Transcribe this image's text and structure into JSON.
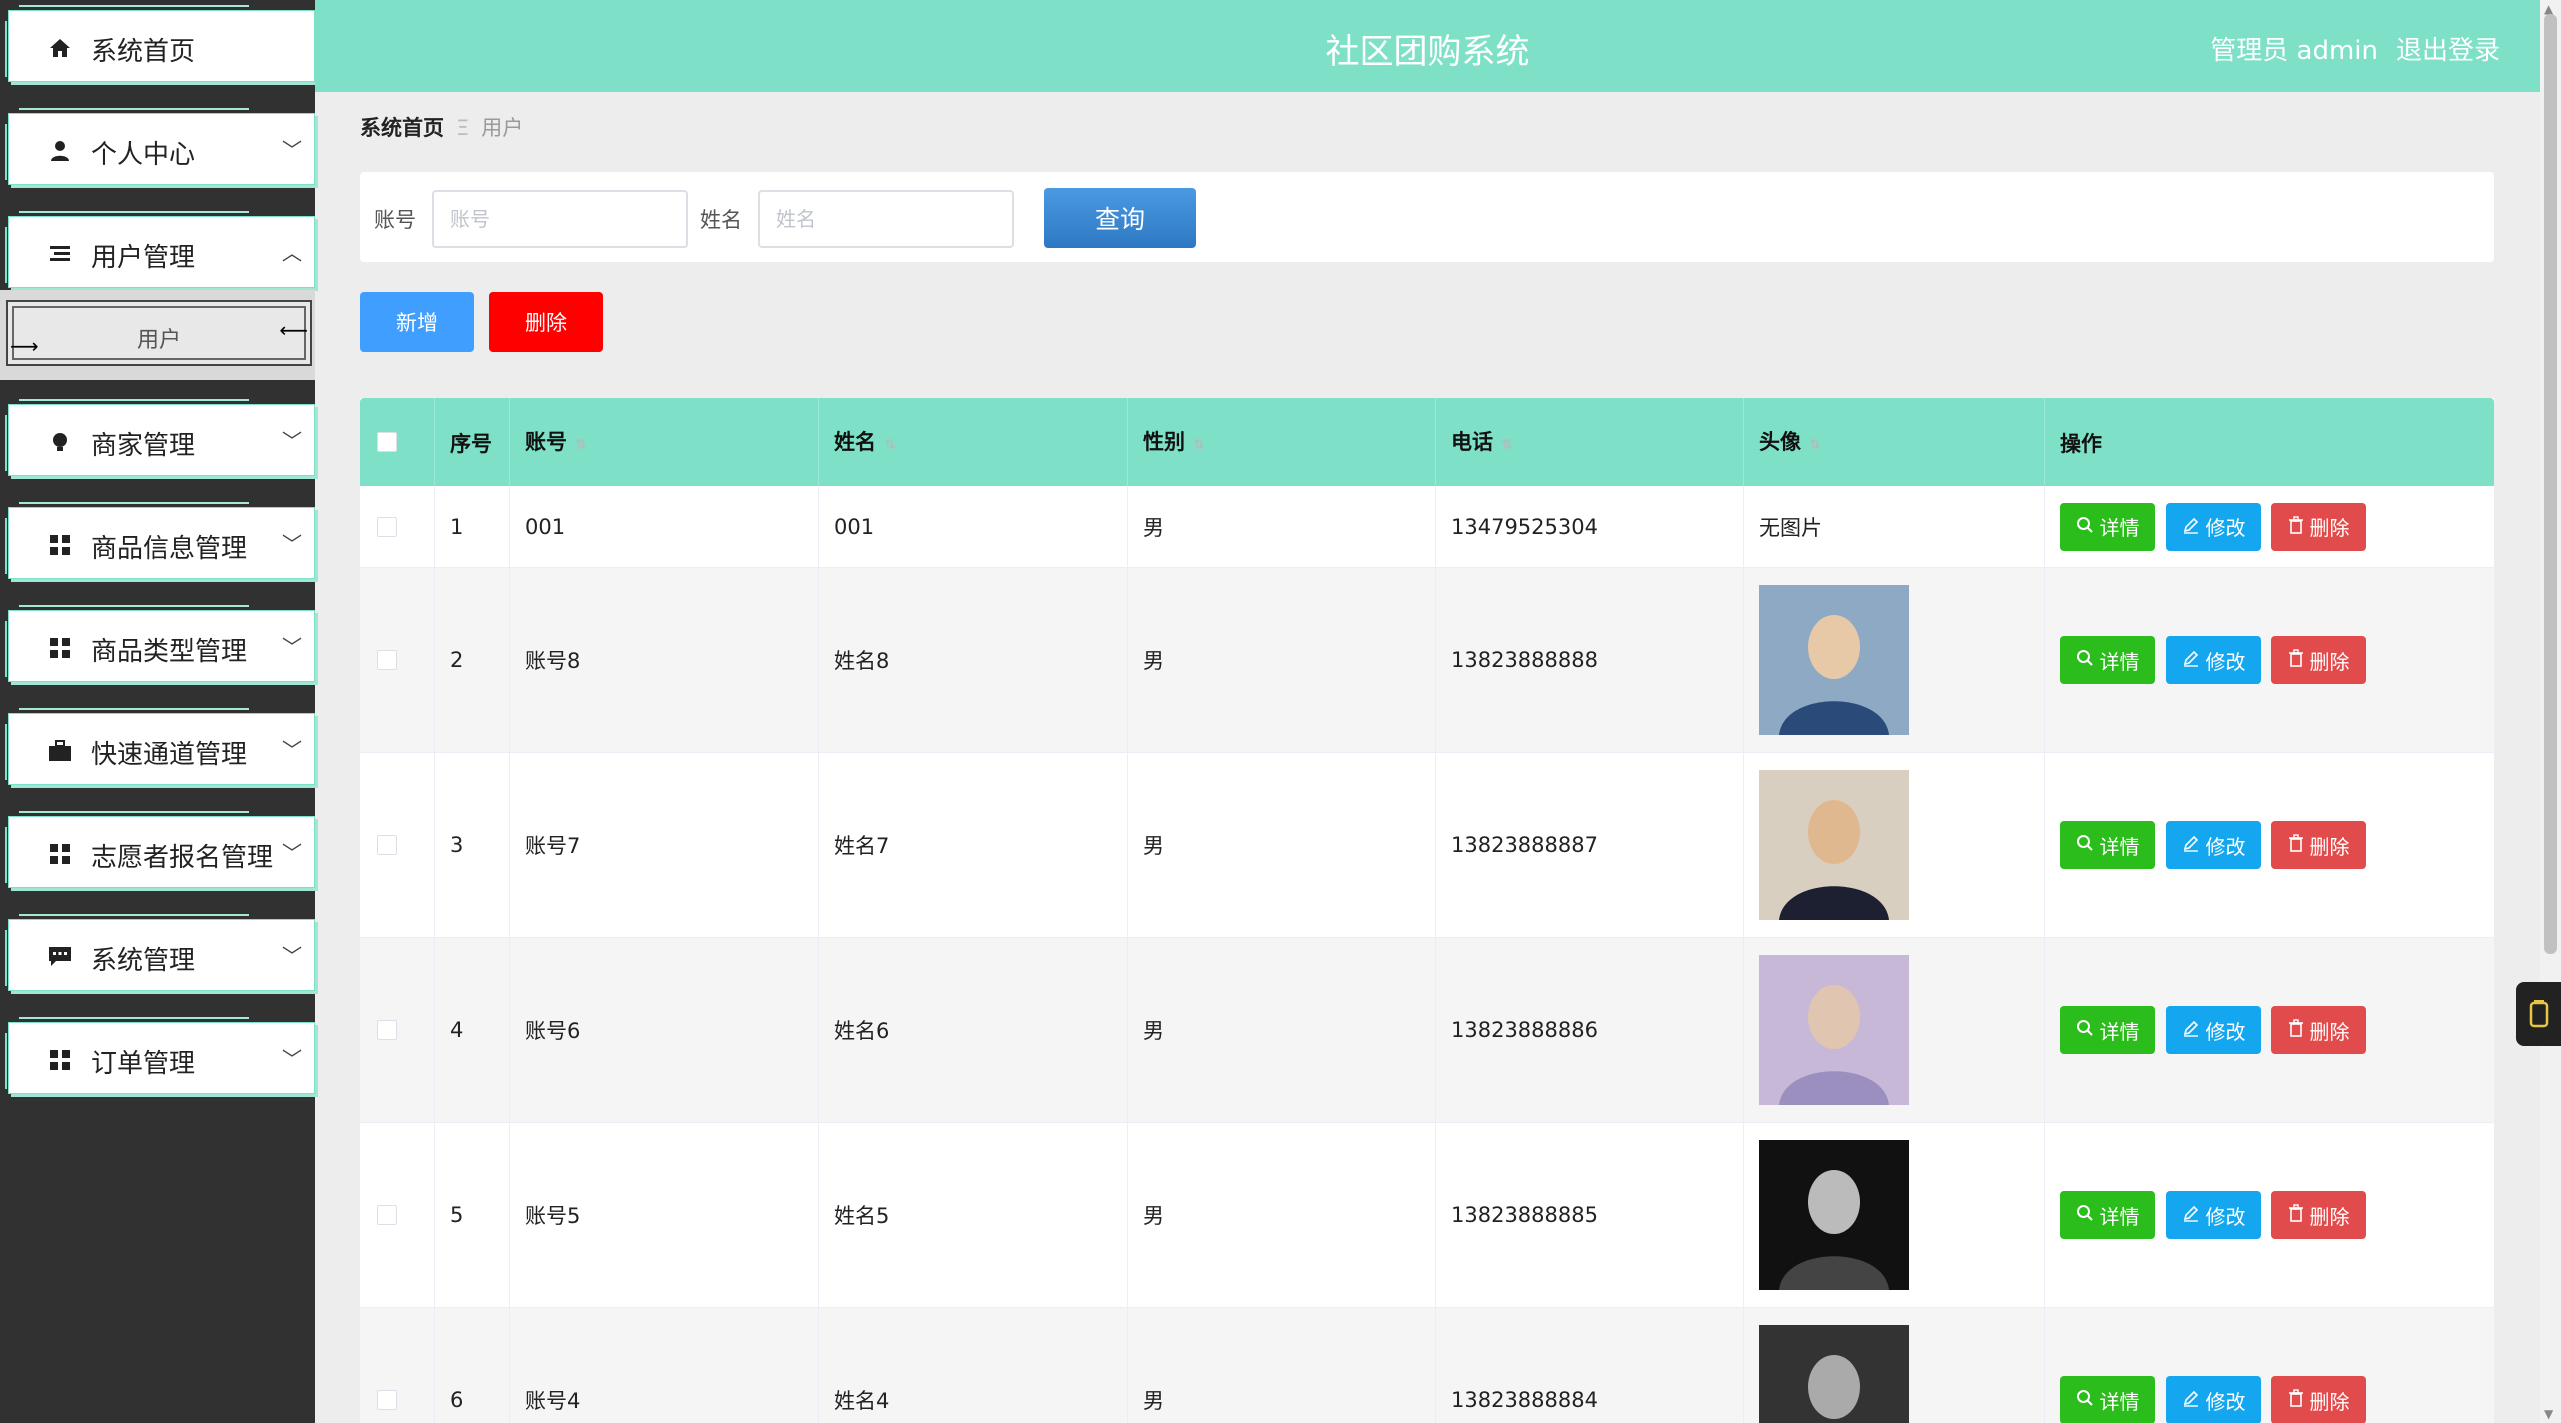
{
  "header": {
    "title": "社区团购系统",
    "user": "管理员 admin",
    "logout": "退出登录"
  },
  "sidebar": {
    "items": [
      {
        "label": "系统首页",
        "icon": "home-icon",
        "glyph": "⌂"
      },
      {
        "label": "个人中心",
        "icon": "person-icon",
        "glyph": "●"
      },
      {
        "label": "用户管理",
        "icon": "list-icon",
        "glyph": "☰"
      },
      {
        "label": "商家管理",
        "icon": "bulb-icon",
        "glyph": "●"
      },
      {
        "label": "商品信息管理",
        "icon": "grid-icon",
        "glyph": "▦"
      },
      {
        "label": "商品类型管理",
        "icon": "grid-icon",
        "glyph": "▦"
      },
      {
        "label": "快速通道管理",
        "icon": "briefcase-icon",
        "glyph": "▬"
      },
      {
        "label": "志愿者报名管理",
        "icon": "grid-icon",
        "glyph": "▦"
      },
      {
        "label": "系统管理",
        "icon": "chat-icon",
        "glyph": "▬"
      },
      {
        "label": "订单管理",
        "icon": "grid-icon",
        "glyph": "▦"
      }
    ],
    "submenu": {
      "label": "用户"
    }
  },
  "breadcrumb": {
    "home": "系统首页",
    "current": "用户"
  },
  "search": {
    "account_label": "账号",
    "account_placeholder": "账号",
    "account_value": "",
    "name_label": "姓名",
    "name_placeholder": "姓名",
    "name_value": "",
    "query_button": "查询"
  },
  "actions": {
    "add": "新增",
    "delete": "删除"
  },
  "table": {
    "headers": {
      "index": "序号",
      "account": "账号",
      "name": "姓名",
      "gender": "性别",
      "phone": "电话",
      "avatar": "头像",
      "ops": "操作"
    },
    "buttons": {
      "detail": "详情",
      "edit": "修改",
      "delete": "删除"
    },
    "rows": [
      {
        "index": "1",
        "account": "001",
        "name": "001",
        "gender": "男",
        "phone": "13479525304",
        "avatar_text": "无图片"
      },
      {
        "index": "2",
        "account": "账号8",
        "name": "姓名8",
        "gender": "男",
        "phone": "13823888888",
        "avatar_text": ""
      },
      {
        "index": "3",
        "account": "账号7",
        "name": "姓名7",
        "gender": "男",
        "phone": "13823888887",
        "avatar_text": ""
      },
      {
        "index": "4",
        "account": "账号6",
        "name": "姓名6",
        "gender": "男",
        "phone": "13823888886",
        "avatar_text": ""
      },
      {
        "index": "5",
        "account": "账号5",
        "name": "姓名5",
        "gender": "男",
        "phone": "13823888885",
        "avatar_text": ""
      },
      {
        "index": "6",
        "account": "账号4",
        "name": "姓名4",
        "gender": "男",
        "phone": "13823888884",
        "avatar_text": ""
      }
    ]
  },
  "colors": {
    "theme": "#7fe0c8",
    "sidebar_bg": "#313131",
    "detail": "#2bbd1c",
    "edit": "#14a7f0",
    "delete": "#e24b4b",
    "add": "#409eff",
    "batch_delete": "#ff0000"
  }
}
